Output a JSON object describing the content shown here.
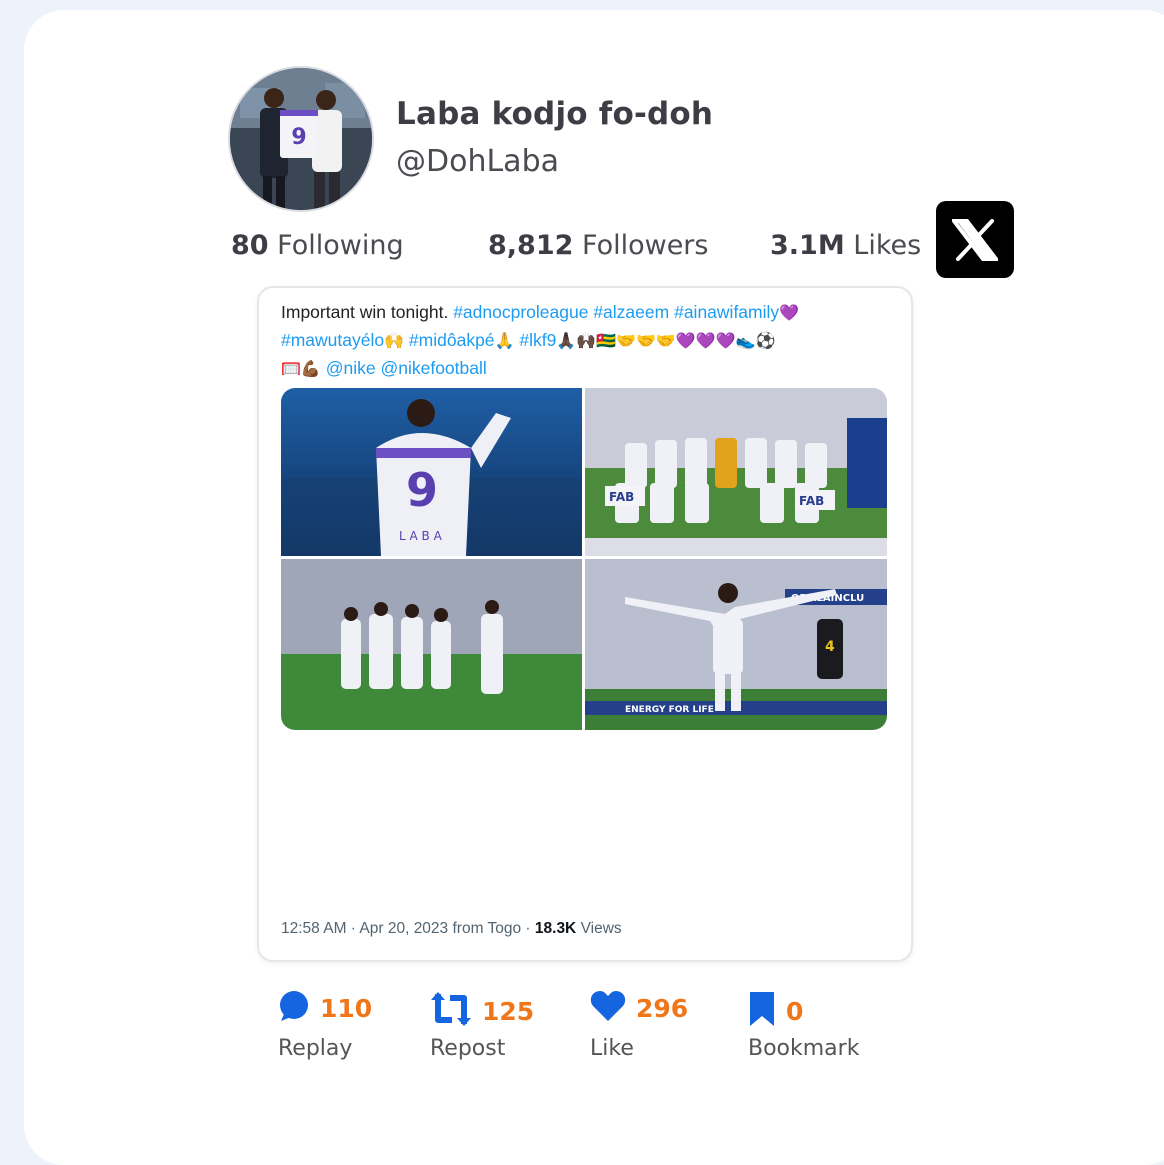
{
  "profile": {
    "name": "Laba kodjo fo-doh",
    "handle": "@DohLaba",
    "avatar_icon": "profile-photo"
  },
  "stats": {
    "following_count": "80",
    "following_label": "Following",
    "followers_count": "8,812",
    "followers_label": "Followers",
    "likes_count": "3.1M",
    "likes_label": "Likes"
  },
  "brand": {
    "logo_icon": "x-logo-icon"
  },
  "tweet": {
    "line1_text": "Important win tonight.",
    "line1_tags": [
      "#adnocproleague",
      "#alzaeem",
      "#ainawifamily"
    ],
    "line1_emoji": "💜",
    "line2_tags": [
      "#mawutayélo",
      "#midôakpé",
      "#lkf9"
    ],
    "line2_emoji": [
      "🙌",
      "🙏",
      "🙏🏿🙌🏿🇹🇬🤝🤝🤝💜💜💜👟⚽"
    ],
    "line3_emoji": "🥅💪🏾",
    "line3_mentions": [
      "@nike",
      "@nikefootball"
    ],
    "timestamp": "12:58 AM · Apr 20, 2023 from Togo · ",
    "views_count": "18.3K",
    "views_label": " Views"
  },
  "actions": [
    {
      "icon": "comment-icon",
      "count": "110",
      "label": "Replay"
    },
    {
      "icon": "repost-icon",
      "count": "125",
      "label": "Repost"
    },
    {
      "icon": "heart-icon",
      "count": "296",
      "label": "Like"
    },
    {
      "icon": "bookmark-icon",
      "count": "0",
      "label": "Bookmark"
    }
  ],
  "colors": {
    "accent_blue": "#1565e0",
    "count_orange": "#f0761a",
    "hashtag_blue": "#1d9bf0",
    "jersey_purple": "#6c4fc2"
  }
}
